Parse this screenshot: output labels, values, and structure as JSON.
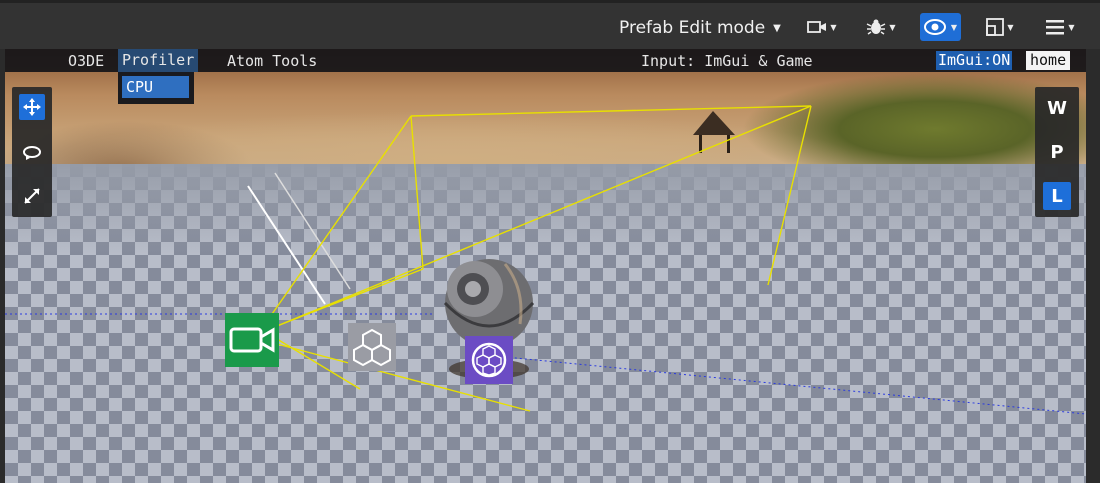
{
  "toolbar": {
    "mode_label": "Prefab Edit mode",
    "icons": [
      "camera-icon",
      "debug-bug-icon",
      "visibility-eye-icon",
      "layout-icon",
      "hamburger-menu-icon"
    ]
  },
  "imgui": {
    "menus": [
      "O3DE",
      "Profiler",
      "Atom Tools"
    ],
    "input_status": "Input: ImGui & Game",
    "imgui_state": "ImGui:ON",
    "home_label": "home",
    "dropdown_item": "CPU"
  },
  "left_toolbar": {
    "tools": [
      "move-icon",
      "rotate-icon",
      "scale-icon"
    ]
  },
  "right_toolbar": {
    "buttons": [
      "W",
      "P",
      "L"
    ],
    "active": "L"
  },
  "colors": {
    "accent": "#1e6fd9",
    "camera_gizmo": "#1a9a4a",
    "entity_gizmo": "#6b4cc4",
    "frustum": "#e8e000"
  }
}
